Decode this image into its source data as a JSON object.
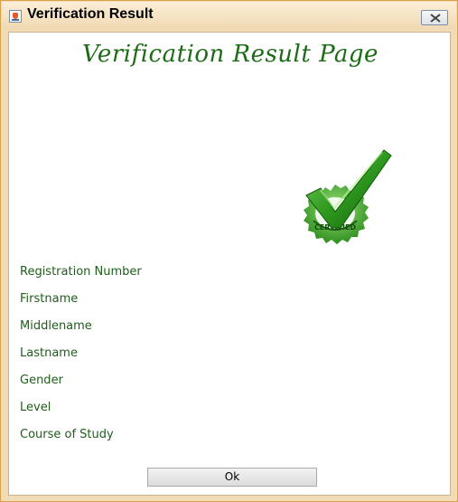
{
  "window": {
    "title": "Verification Result",
    "icon": "java-app-icon",
    "close_icon": "close-icon"
  },
  "page": {
    "heading": "Verification Result Page",
    "seal_image": "certified-checkmark-icon",
    "seal_text": "CERTIFIED"
  },
  "fields": [
    {
      "label": "Registration Number"
    },
    {
      "label": "Firstname"
    },
    {
      "label": "Middlename"
    },
    {
      "label": "Lastname"
    },
    {
      "label": "Gender"
    },
    {
      "label": "Level"
    },
    {
      "label": "Course of Study"
    }
  ],
  "buttons": {
    "ok_label": "Ok"
  },
  "colors": {
    "label_green": "#1f5d1b",
    "heading_green": "#1c6b16",
    "seal_green": "#3fae2a",
    "title_bar": "#f0d9b2"
  }
}
